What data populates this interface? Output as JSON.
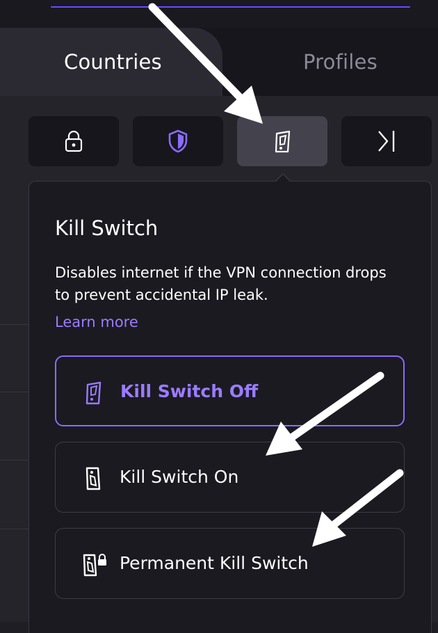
{
  "tabs": {
    "countries": "Countries",
    "profiles": "Profiles"
  },
  "feature_buttons": [
    {
      "icon": "lock-icon"
    },
    {
      "icon": "shield-icon"
    },
    {
      "icon": "kill-switch-icon",
      "selected": true
    },
    {
      "icon": "port-forward-icon"
    }
  ],
  "popover": {
    "title": "Kill Switch",
    "description": "Disables internet if the VPN connection drops to prevent accidental IP leak.",
    "learn_more": "Learn more",
    "options": [
      {
        "label": "Kill Switch Off",
        "icon": "kill-switch-off-icon",
        "selected": true
      },
      {
        "label": "Kill Switch On",
        "icon": "kill-switch-on-icon",
        "selected": false
      },
      {
        "label": "Permanent Kill Switch",
        "icon": "permanent-kill-switch-icon",
        "selected": false
      }
    ]
  },
  "colors": {
    "accent": "#6d4aff",
    "accent_text": "#9b7cff",
    "background": "#1f1e25",
    "panel": "#1b1a21",
    "annotation_arrow": "#ffffff"
  }
}
